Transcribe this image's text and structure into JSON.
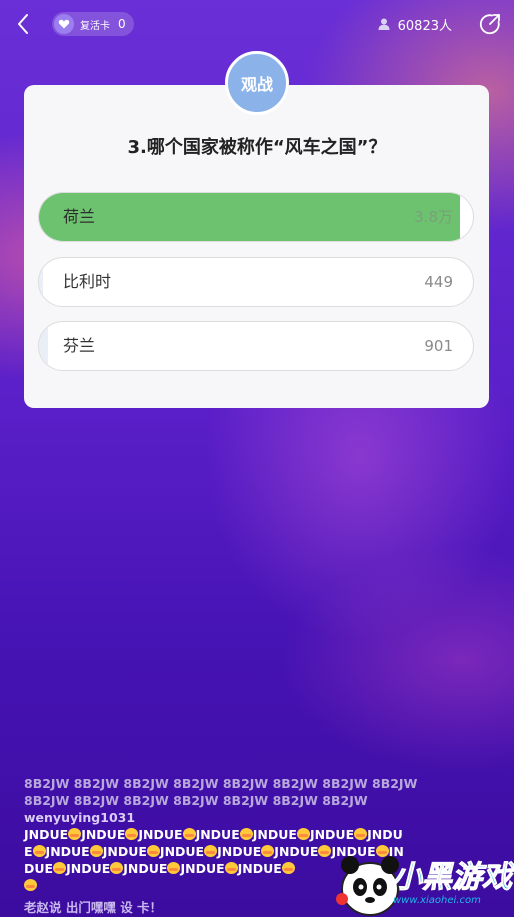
{
  "header": {
    "revive_label": "复活卡",
    "revive_count": "0",
    "viewer_count": "60823人"
  },
  "card": {
    "badge": "观战",
    "question": "3.哪个国家被称作“风车之国”？",
    "options": [
      {
        "label": "荷兰",
        "count": "3.8万",
        "fill_fraction": 0.97,
        "correct": true
      },
      {
        "label": "比利时",
        "count": "449",
        "fill_fraction": 0.01,
        "correct": false
      },
      {
        "label": "芬兰",
        "count": "901",
        "fill_fraction": 0.02,
        "correct": false
      }
    ]
  },
  "comments": {
    "line1": "8B2JW 8B2JW 8B2JW 8B2JW 8B2JW 8B2JW 8B2JW 8B2JW",
    "line2": "8B2JW 8B2JW 8B2JW 8B2JW 8B2JW 8B2JW 8B2JW",
    "username": "wenyuying1031",
    "spam_unit": "JNDUE",
    "cut_line": "老赵说 出门嘿嘿 设 卡！"
  },
  "watermark": {
    "logo_text": "小黑游戏",
    "url": "www.xiaohei.com"
  },
  "colors": {
    "correct_fill": "#6dc26f",
    "badge": "#8bb3ea",
    "card": "#f7f7f9"
  },
  "icons": [
    "back-icon",
    "heart-icon",
    "person-icon",
    "share-icon"
  ]
}
